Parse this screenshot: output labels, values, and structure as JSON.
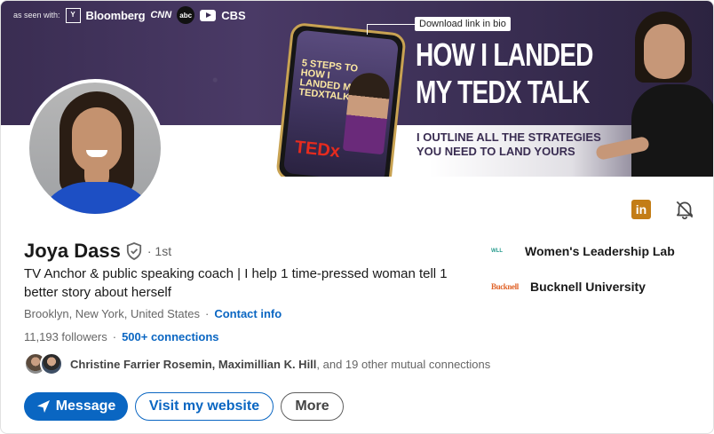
{
  "banner": {
    "as_seen_label": "as seen with:",
    "logo_box": "Y",
    "bloomberg": "Bloomberg",
    "cnn": "CNN",
    "abc": "abc",
    "cbs": "CBS",
    "download_label": "Download link in bio",
    "headline_line1": "HOW I LANDED",
    "headline_line2": "MY TEDX TALK",
    "subline_line1": "I OUTLINE ALL THE STRATEGIES",
    "subline_line2": "YOU NEED TO LAND YOURS",
    "phone_title": "5 STEPS TO HOW I LANDED MY TEDXTALK",
    "phone_tedx": "TEDx"
  },
  "profile": {
    "name": "Joya Dass",
    "degree": "· 1st",
    "headline": "TV Anchor & public speaking coach | I help 1 time-pressed woman tell 1 better story about herself",
    "location": "Brooklyn, New York, United States",
    "contact_info": "Contact info",
    "followers": "11,193 followers",
    "separator": "·",
    "connections": "500+ connections",
    "mutual_names": "Christine Farrier Rosemin, Maximillian K. Hill",
    "mutual_rest": ", and 19 other mutual connections"
  },
  "actions": {
    "message": "Message",
    "visit_website": "Visit my website",
    "more": "More"
  },
  "top_icons": {
    "linkedin_label": "in"
  },
  "orgs": [
    {
      "logo_text": "WLL",
      "name": "Women's Leadership Lab"
    },
    {
      "logo_text": "Bucknell",
      "name": "Bucknell University"
    }
  ],
  "colors": {
    "accent": "#0a66c2",
    "linkedin_badge": "#c37d16",
    "banner_purple": "#3a2d52"
  }
}
